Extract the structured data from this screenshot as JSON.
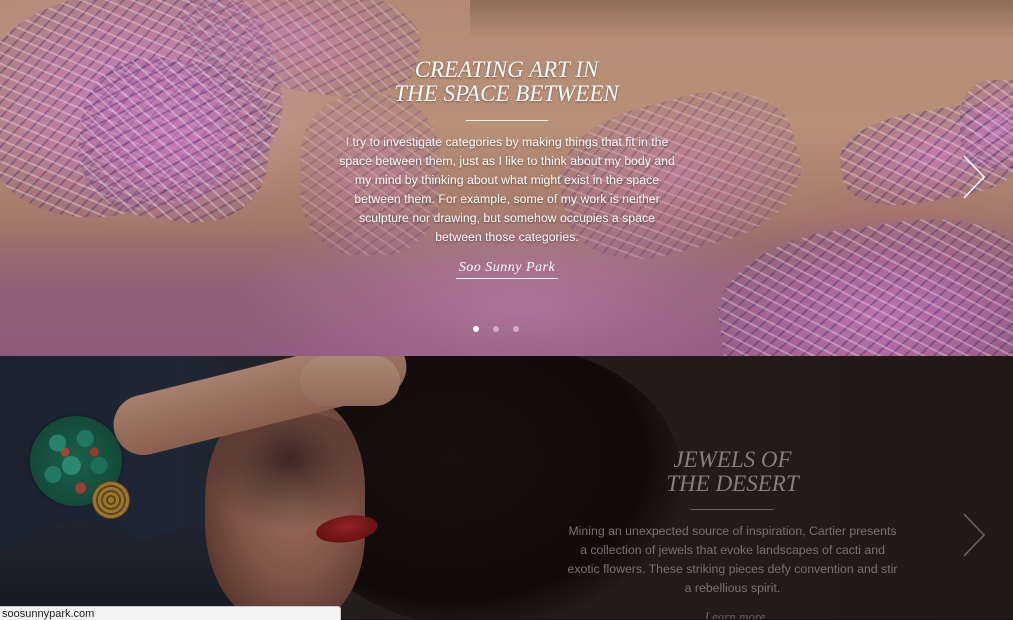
{
  "slides": [
    {
      "title_line1": "CREATING ART IN",
      "title_line2": "THE SPACE BETWEEN",
      "body": "I try to investigate categories by making things that fit in the space between them, just as I like to think about my body and my mind by thinking about what might exist in the space between them. For example, some of my work is neither sculpture nor drawing, but somehow occupies a space between those categories.",
      "cta": "Soo Sunny Park",
      "next_icon": "chevron-right-icon"
    },
    {
      "title_line1": "JEWELS OF",
      "title_line2": "THE DESERT",
      "body": "Mining an unexpected source of inspiration, Cartier presents a collection of jewels that evoke landscapes of cacti and exotic flowers. These striking pieces defy convention and stir a rebellious spirit.",
      "cta": "Learn more",
      "next_icon": "chevron-right-icon"
    }
  ],
  "carousel": {
    "dots": [
      {
        "active": true
      },
      {
        "active": false
      },
      {
        "active": false
      }
    ]
  },
  "status_bar": {
    "url": "soosunnypark.com"
  },
  "colors": {
    "text_light": "#ffffff",
    "text_dim": "#8b7d77"
  }
}
